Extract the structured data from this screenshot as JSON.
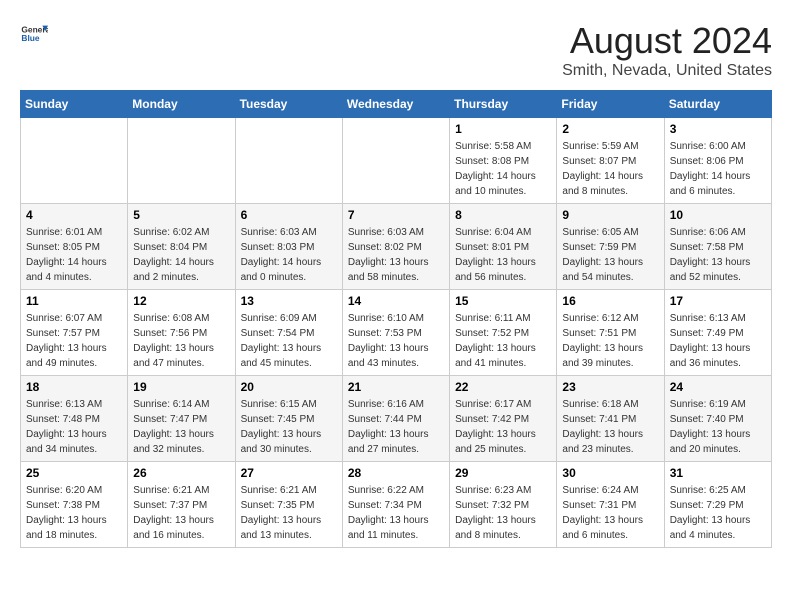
{
  "header": {
    "logo_line1": "General",
    "logo_line2": "Blue",
    "title": "August 2024",
    "subtitle": "Smith, Nevada, United States"
  },
  "calendar": {
    "days_of_week": [
      "Sunday",
      "Monday",
      "Tuesday",
      "Wednesday",
      "Thursday",
      "Friday",
      "Saturday"
    ],
    "weeks": [
      [
        {
          "day": "",
          "info": ""
        },
        {
          "day": "",
          "info": ""
        },
        {
          "day": "",
          "info": ""
        },
        {
          "day": "",
          "info": ""
        },
        {
          "day": "1",
          "info": "Sunrise: 5:58 AM\nSunset: 8:08 PM\nDaylight: 14 hours\nand 10 minutes."
        },
        {
          "day": "2",
          "info": "Sunrise: 5:59 AM\nSunset: 8:07 PM\nDaylight: 14 hours\nand 8 minutes."
        },
        {
          "day": "3",
          "info": "Sunrise: 6:00 AM\nSunset: 8:06 PM\nDaylight: 14 hours\nand 6 minutes."
        }
      ],
      [
        {
          "day": "4",
          "info": "Sunrise: 6:01 AM\nSunset: 8:05 PM\nDaylight: 14 hours\nand 4 minutes."
        },
        {
          "day": "5",
          "info": "Sunrise: 6:02 AM\nSunset: 8:04 PM\nDaylight: 14 hours\nand 2 minutes."
        },
        {
          "day": "6",
          "info": "Sunrise: 6:03 AM\nSunset: 8:03 PM\nDaylight: 14 hours\nand 0 minutes."
        },
        {
          "day": "7",
          "info": "Sunrise: 6:03 AM\nSunset: 8:02 PM\nDaylight: 13 hours\nand 58 minutes."
        },
        {
          "day": "8",
          "info": "Sunrise: 6:04 AM\nSunset: 8:01 PM\nDaylight: 13 hours\nand 56 minutes."
        },
        {
          "day": "9",
          "info": "Sunrise: 6:05 AM\nSunset: 7:59 PM\nDaylight: 13 hours\nand 54 minutes."
        },
        {
          "day": "10",
          "info": "Sunrise: 6:06 AM\nSunset: 7:58 PM\nDaylight: 13 hours\nand 52 minutes."
        }
      ],
      [
        {
          "day": "11",
          "info": "Sunrise: 6:07 AM\nSunset: 7:57 PM\nDaylight: 13 hours\nand 49 minutes."
        },
        {
          "day": "12",
          "info": "Sunrise: 6:08 AM\nSunset: 7:56 PM\nDaylight: 13 hours\nand 47 minutes."
        },
        {
          "day": "13",
          "info": "Sunrise: 6:09 AM\nSunset: 7:54 PM\nDaylight: 13 hours\nand 45 minutes."
        },
        {
          "day": "14",
          "info": "Sunrise: 6:10 AM\nSunset: 7:53 PM\nDaylight: 13 hours\nand 43 minutes."
        },
        {
          "day": "15",
          "info": "Sunrise: 6:11 AM\nSunset: 7:52 PM\nDaylight: 13 hours\nand 41 minutes."
        },
        {
          "day": "16",
          "info": "Sunrise: 6:12 AM\nSunset: 7:51 PM\nDaylight: 13 hours\nand 39 minutes."
        },
        {
          "day": "17",
          "info": "Sunrise: 6:13 AM\nSunset: 7:49 PM\nDaylight: 13 hours\nand 36 minutes."
        }
      ],
      [
        {
          "day": "18",
          "info": "Sunrise: 6:13 AM\nSunset: 7:48 PM\nDaylight: 13 hours\nand 34 minutes."
        },
        {
          "day": "19",
          "info": "Sunrise: 6:14 AM\nSunset: 7:47 PM\nDaylight: 13 hours\nand 32 minutes."
        },
        {
          "day": "20",
          "info": "Sunrise: 6:15 AM\nSunset: 7:45 PM\nDaylight: 13 hours\nand 30 minutes."
        },
        {
          "day": "21",
          "info": "Sunrise: 6:16 AM\nSunset: 7:44 PM\nDaylight: 13 hours\nand 27 minutes."
        },
        {
          "day": "22",
          "info": "Sunrise: 6:17 AM\nSunset: 7:42 PM\nDaylight: 13 hours\nand 25 minutes."
        },
        {
          "day": "23",
          "info": "Sunrise: 6:18 AM\nSunset: 7:41 PM\nDaylight: 13 hours\nand 23 minutes."
        },
        {
          "day": "24",
          "info": "Sunrise: 6:19 AM\nSunset: 7:40 PM\nDaylight: 13 hours\nand 20 minutes."
        }
      ],
      [
        {
          "day": "25",
          "info": "Sunrise: 6:20 AM\nSunset: 7:38 PM\nDaylight: 13 hours\nand 18 minutes."
        },
        {
          "day": "26",
          "info": "Sunrise: 6:21 AM\nSunset: 7:37 PM\nDaylight: 13 hours\nand 16 minutes."
        },
        {
          "day": "27",
          "info": "Sunrise: 6:21 AM\nSunset: 7:35 PM\nDaylight: 13 hours\nand 13 minutes."
        },
        {
          "day": "28",
          "info": "Sunrise: 6:22 AM\nSunset: 7:34 PM\nDaylight: 13 hours\nand 11 minutes."
        },
        {
          "day": "29",
          "info": "Sunrise: 6:23 AM\nSunset: 7:32 PM\nDaylight: 13 hours\nand 8 minutes."
        },
        {
          "day": "30",
          "info": "Sunrise: 6:24 AM\nSunset: 7:31 PM\nDaylight: 13 hours\nand 6 minutes."
        },
        {
          "day": "31",
          "info": "Sunrise: 6:25 AM\nSunset: 7:29 PM\nDaylight: 13 hours\nand 4 minutes."
        }
      ]
    ]
  }
}
